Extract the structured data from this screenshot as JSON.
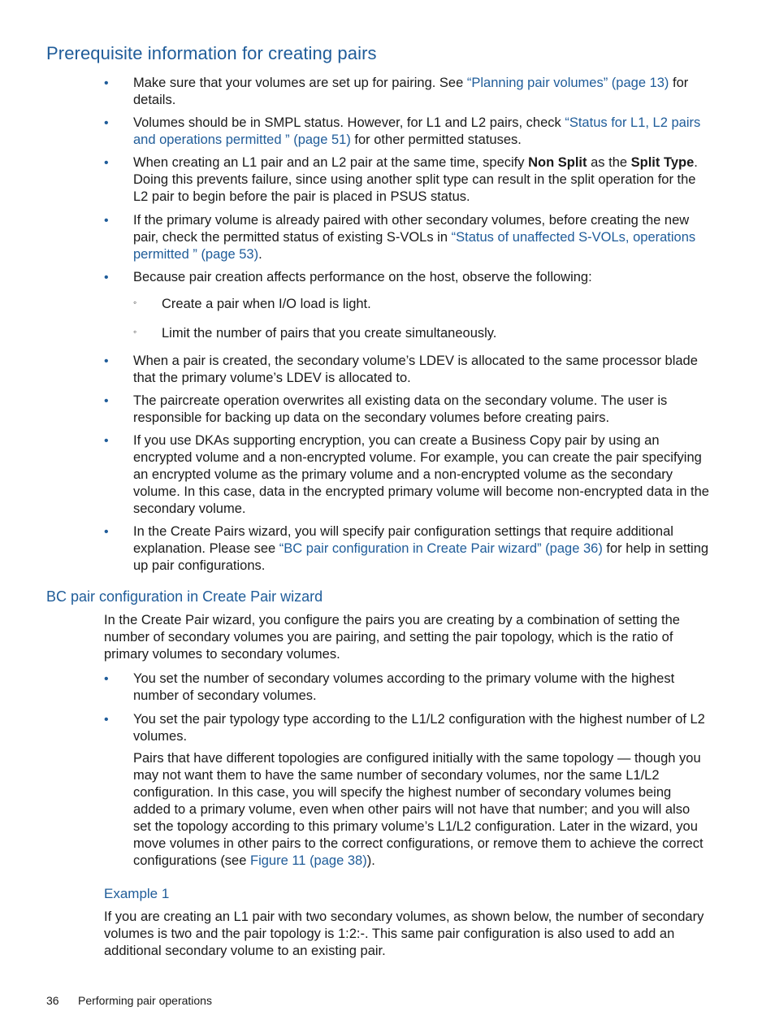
{
  "section1": {
    "title": "Prerequisite information for creating pairs",
    "bullets": [
      {
        "pre": "Make sure that your volumes are set up for pairing. See ",
        "link": "“Planning pair volumes” (page 13)",
        "post": " for details."
      },
      {
        "pre": "Volumes should be in SMPL status. However, for L1 and L2 pairs, check ",
        "link": "“Status for L1, L2 pairs and operations permitted ” (page 51)",
        "post": " for other permitted statuses."
      },
      {
        "pre": "When creating an L1 pair and an L2 pair at the same time, specify ",
        "bold1": "Non Split",
        "mid": " as the ",
        "bold2": "Split Type",
        "post": ". Doing this prevents failure, since using another split type can result in the split operation for the L2 pair to begin before the pair is placed in PSUS status."
      },
      {
        "pre": "If the primary volume is already paired with other secondary volumes, before creating the new pair, check the permitted status of existing S-VOLs in ",
        "link": "“Status of unaffected S-VOLs, operations permitted ” (page 53)",
        "post": "."
      },
      {
        "text": "Because pair creation affects performance on the host, observe the following:"
      },
      {
        "text": "When a pair is created, the secondary volume’s LDEV is allocated to the same processor blade that the primary volume’s LDEV is allocated to."
      },
      {
        "text": "The paircreate operation overwrites all existing data on the secondary volume. The user is responsible for backing up data on the secondary volumes before creating pairs."
      },
      {
        "text": "If you use DKAs supporting encryption, you can create a Business Copy pair by using an encrypted volume and a non-encrypted volume. For example, you can create the pair specifying an encrypted volume as the primary volume and a non-encrypted volume as the secondary volume. In this case, data in the encrypted primary volume will become non-encrypted data in the secondary volume."
      },
      {
        "pre": "In the Create Pairs wizard, you will specify pair configuration settings that require additional explanation. Please see ",
        "link": "“BC pair configuration in Create Pair wizard” (page 36)",
        "post": " for help in setting up pair configurations."
      }
    ],
    "sub_bullets": [
      "Create a pair when I/O load is light.",
      "Limit the number of pairs that you create simultaneously."
    ],
    "bullet_glyph": "•",
    "sub_bullet_glyph": "◦"
  },
  "section2": {
    "title": "BC pair configuration in Create Pair wizard",
    "intro": "In the Create Pair wizard, you configure the pairs you are creating by a combination of setting the number of secondary volumes you are pairing, and setting the pair topology, which is the ratio of primary volumes to secondary volumes.",
    "bullets": [
      "You set the number of secondary volumes according to the primary volume with the highest number of secondary volumes.",
      "You set the pair typology type according to the L1/L2 configuration with the highest number of L2 volumes."
    ],
    "follow_para": {
      "pre": "Pairs that have different topologies are configured initially with the same topology — though you may not want them to have the same number of secondary volumes, nor the same L1/L2 configuration. In this case, you will specify the highest number of secondary volumes being added to a primary volume, even when other pairs will not have that number; and you will also set the topology according to this primary volume’s L1/L2 configuration. Later in the wizard, you move volumes in other pairs to the correct configurations, or remove them to achieve the correct configurations (see ",
      "link": "Figure 11 (page 38)",
      "post": ")."
    },
    "example": {
      "title": "Example 1",
      "text": "If you are creating an L1 pair with two secondary volumes, as shown below, the number of secondary volumes is two and the pair topology is 1:2:-. This same pair configuration is also used to add an additional secondary volume to an existing pair."
    }
  },
  "footer": {
    "page_number": "36",
    "chapter": "Performing pair operations"
  }
}
